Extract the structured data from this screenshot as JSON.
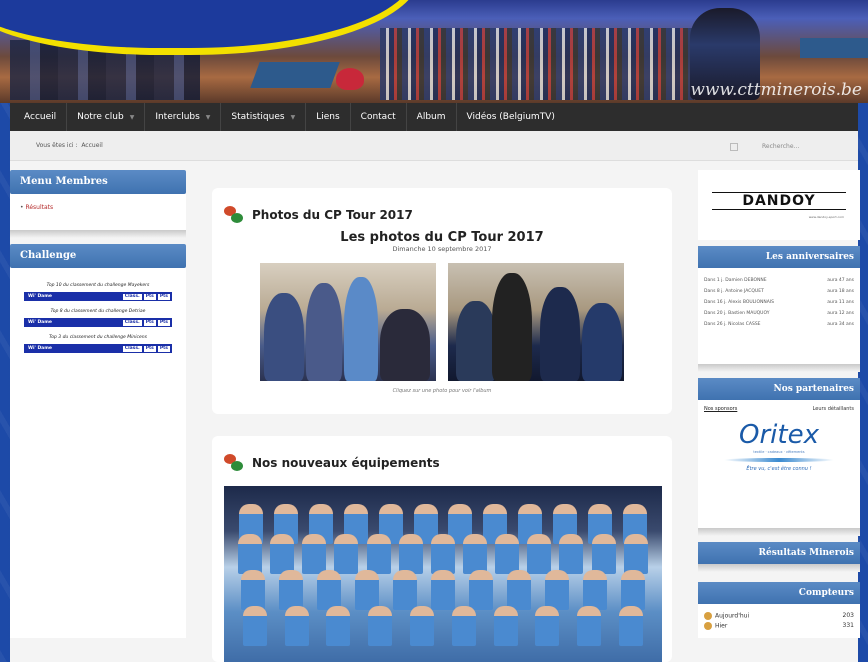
{
  "site": {
    "url_watermark": "www.cttminerois.be"
  },
  "nav": {
    "items": [
      {
        "label": "Accueil",
        "has_sub": false
      },
      {
        "label": "Notre club",
        "has_sub": true
      },
      {
        "label": "Interclubs",
        "has_sub": true
      },
      {
        "label": "Statistiques",
        "has_sub": true
      },
      {
        "label": "Liens",
        "has_sub": false
      },
      {
        "label": "Contact",
        "has_sub": false
      },
      {
        "label": "Album",
        "has_sub": false
      },
      {
        "label": "Vidéos (BelgiumTV)",
        "has_sub": false
      }
    ]
  },
  "breadcrumb": {
    "prefix": "Vous êtes ici :",
    "current": "Accueil"
  },
  "search": {
    "placeholder": "Recherche..."
  },
  "left_sidebar": {
    "menu_title": "Menu Membres",
    "menu_items": [
      "Résultats"
    ],
    "challenge_title": "Challenge",
    "challenge_blocks": [
      {
        "caption": "Top 10 du classement du challenge Mayekers",
        "select_label": "Wi' Dame",
        "buttons": [
          "Class.",
          "Pts",
          "Pts"
        ]
      },
      {
        "caption": "Top 8 du classement du challenge Detriae",
        "select_label": "Wi' Dame",
        "buttons": [
          "Class.",
          "Pts",
          "Pts"
        ]
      },
      {
        "caption": "Top 3 du classement du challenge Minicens",
        "select_label": "Wi' Dame",
        "buttons": [
          "Class.",
          "Pts",
          "Pts"
        ]
      }
    ]
  },
  "posts": [
    {
      "title": "Photos du CP Tour 2017",
      "subtitle": "Les photos du CP Tour 2017",
      "date": "Dimanche 10 septembre 2017",
      "caption": "Cliquez sur une photo pour voir l'album"
    },
    {
      "title": "Nos nouveaux équipements"
    }
  ],
  "right_sidebar": {
    "sponsor_name": "DANDOY",
    "sponsor_tagline": "www.dandoy-sport.com",
    "anniversaries_title": "Les anniversaires",
    "anniversaries": [
      {
        "who": "Dans 1 j. Damien DEBONNE",
        "age": "aura 47 ans"
      },
      {
        "who": "Dans 8 j. Antoine JACQUET",
        "age": "aura 18 ans"
      },
      {
        "who": "Dans 16 j. Alexis BOULIONNAIS",
        "age": "aura 11 ans"
      },
      {
        "who": "Dans 20 j. Bastien MAUQUOY",
        "age": "aura 12 ans"
      },
      {
        "who": "Dans 26 j. Nicolas CASSE",
        "age": "aura 34 ans"
      }
    ],
    "partners_title": "Nos partenaires",
    "partners_link": "Nos sponsors",
    "partners_other": "Leurs détaillants",
    "oritex_name": "Oritex",
    "oritex_tagline": "textile · cadeaux · vêtements",
    "oritex_slogan": "Être vu, c'est être connu !",
    "results_title": "Résultats Minerois",
    "counters_title": "Compteurs",
    "counters": [
      {
        "label": "Aujourd'hui",
        "value": "203"
      },
      {
        "label": "Hier",
        "value": "331"
      }
    ]
  }
}
